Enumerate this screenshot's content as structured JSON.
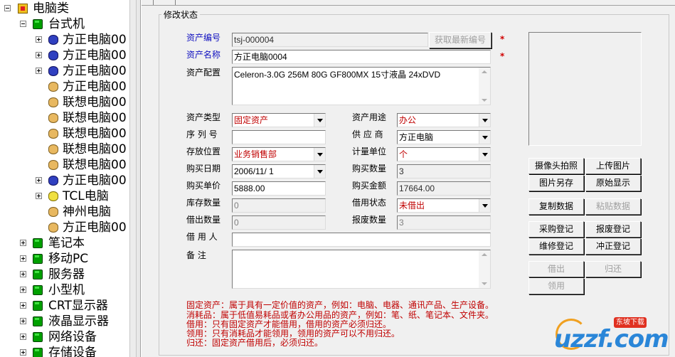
{
  "tree": {
    "root": "电脑类",
    "desktop": "台式机",
    "items": [
      {
        "label": "方正电脑00",
        "icon": "blue-disk-icon",
        "expandable": true
      },
      {
        "label": "方正电脑00",
        "icon": "blue-disk-icon",
        "expandable": true
      },
      {
        "label": "方正电脑00",
        "icon": "blue-disk-icon",
        "expandable": true
      },
      {
        "label": "方正电脑00",
        "icon": "tan-disk-icon",
        "expandable": false
      },
      {
        "label": "联想电脑00",
        "icon": "tan-disk-icon",
        "expandable": false
      },
      {
        "label": "联想电脑00",
        "icon": "tan-disk-icon",
        "expandable": false
      },
      {
        "label": "联想电脑00",
        "icon": "tan-disk-icon",
        "expandable": false
      },
      {
        "label": "联想电脑00",
        "icon": "tan-disk-icon",
        "expandable": false
      },
      {
        "label": "联想电脑00",
        "icon": "tan-disk-icon",
        "expandable": false
      },
      {
        "label": "方正电脑00",
        "icon": "blue-disk-icon",
        "expandable": true
      },
      {
        "label": "TCL电脑",
        "icon": "yellow-disk-icon",
        "expandable": true
      },
      {
        "label": "神州电脑",
        "icon": "tan-disk-icon",
        "expandable": false
      },
      {
        "label": "方正电脑00",
        "icon": "tan-disk-icon",
        "expandable": false
      }
    ],
    "categories": [
      "笔记本",
      "移动PC",
      "服务器",
      "小型机",
      "CRT显示器",
      "液晶显示器",
      "网络设备",
      "存储设备"
    ]
  },
  "form": {
    "group_title": "修改状态",
    "asset_no_label": "资产编号",
    "asset_no_value": "tsj-000004",
    "get_no_button": "获取最新编号",
    "asset_name_label": "资产名称",
    "asset_name_value": "方正电脑0004",
    "config_label": "资产配置",
    "config_value": "Celeron-3.0G 256M 80G GF800MX 15寸液晶 24xDVD",
    "type_label": "资产类型",
    "type_value": "固定资产",
    "use_label": "资产用途",
    "use_value": "办公",
    "serial_label": "序 列 号",
    "serial_value": "",
    "supplier_label": "供 应 商",
    "supplier_value": "方正电脑",
    "location_label": "存放位置",
    "location_value": "业务销售部",
    "unit_label": "计量单位",
    "unit_value": "个",
    "buy_date_label": "购买日期",
    "buy_date_value": "2006/11/ 1",
    "buy_qty_label": "购买数量",
    "buy_qty_value": "3",
    "price_label": "购买单价",
    "price_value": "5888.00",
    "amount_label": "购买金额",
    "amount_value": "17664.00",
    "stock_label": "库存数量",
    "stock_value": "0",
    "borrow_state_label": "借用状态",
    "borrow_state_value": "未借出",
    "lent_label": "借出数量",
    "lent_value": "0",
    "scrap_label": "报废数量",
    "scrap_value": "3",
    "borrower_label": "借 用 人",
    "borrower_value": "",
    "remark_label": "备    注",
    "remark_value": "",
    "required_mark": "*"
  },
  "buttons": {
    "camera": "摄像头拍照",
    "upload": "上传图片",
    "save_image": "图片另存",
    "original": "原始显示",
    "copy": "复制数据",
    "paste": "粘贴数据",
    "purchase": "采购登记",
    "scrap": "报废登记",
    "repair": "维修登记",
    "reverse": "冲正登记",
    "lend": "借出",
    "return": "归还",
    "receive": "领用"
  },
  "notes": [
    "固定资产：属于具有一定价值的资产，例如：电脑、电器、通讯产品、生产设备。",
    "消耗品：属于低值易耗品或者办公用品的资产，例如：笔、纸、笔记本、文件夹。",
    "借用：只有固定资产才能借用，借用的资产必须归还。",
    "领用：只有消耗品才能领用，领用的资产可以不用归还。",
    "归还：固定资产借用后，必须归还。"
  ],
  "watermark": {
    "logo": "uzzf.com",
    "badge": "东坡下载"
  },
  "colors": {
    "label_blue": "#1010c0",
    "value_red": "#c00000",
    "required_red": "#d00000",
    "panel_bg": "#f0f0f0"
  }
}
